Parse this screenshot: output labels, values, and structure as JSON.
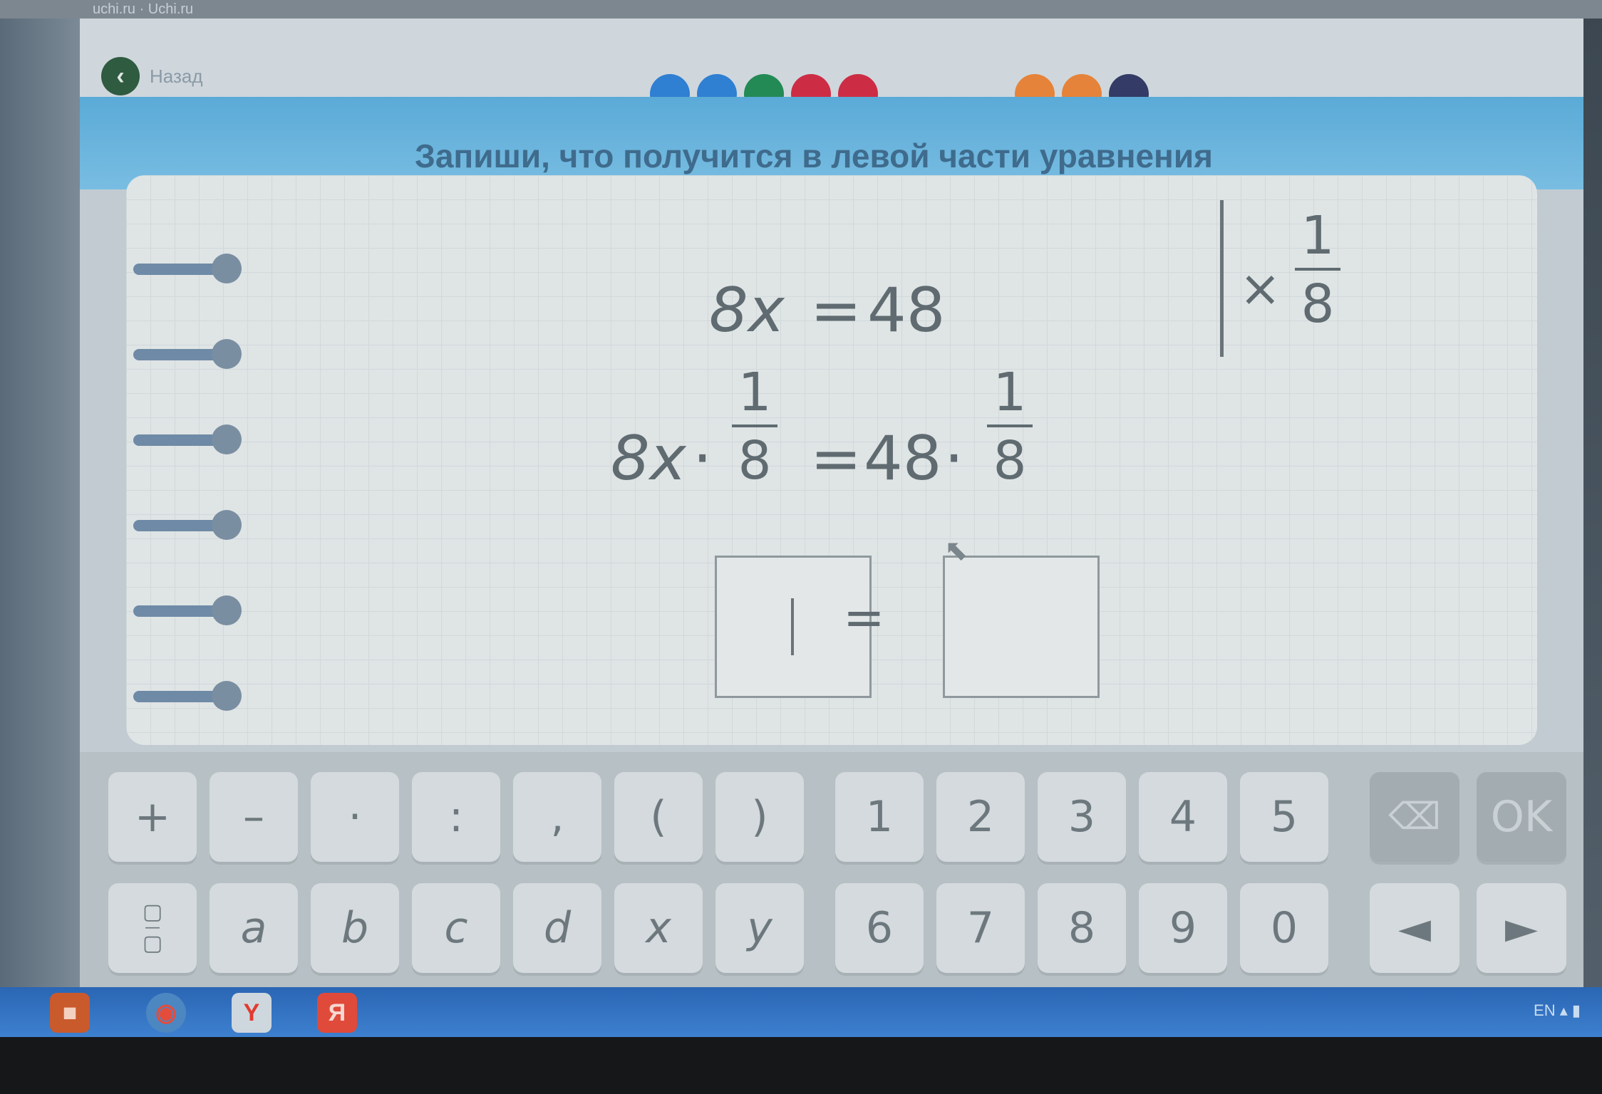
{
  "browser": {
    "tab_text": "uchi.ru · Uchi.ru"
  },
  "nav": {
    "back_label": "Назад"
  },
  "progress_dots": [
    {
      "color": "#2f7fd2"
    },
    {
      "color": "#2f7fd2"
    },
    {
      "color": "#238a55"
    },
    {
      "color": "#cc2d45"
    },
    {
      "color": "#cc2d45"
    },
    {
      "color": "#e6833a"
    },
    {
      "color": "#e6833a"
    },
    {
      "color": "#343b66"
    }
  ],
  "task": {
    "title": "Запиши, что получится в левой части уравнения"
  },
  "equation": {
    "line1_left": "8x",
    "line1_eq": "=",
    "line1_right": "48",
    "op_sign": "×",
    "op_num": "1",
    "op_den": "8",
    "line2_left": "8x",
    "line2_dot1": "·",
    "line2_num1": "1",
    "line2_den1": "8",
    "line2_eq": "=",
    "line2_right": "48",
    "line2_dot2": "·",
    "line2_num2": "1",
    "line2_den2": "8",
    "line3_eq": "="
  },
  "answer": {
    "left_value": "",
    "right_value": ""
  },
  "keyboard": {
    "row1": [
      "+",
      "–",
      "·",
      ":",
      ",",
      "(",
      ")",
      "1",
      "2",
      "3",
      "4",
      "5"
    ],
    "row2": [
      "a",
      "b",
      "c",
      "d",
      "x",
      "y",
      "6",
      "7",
      "8",
      "9",
      "0"
    ],
    "ok_label": "OK",
    "backspace_icon": "backspace-icon",
    "fraction_icon": "fraction-icon",
    "left_arrow": "◄",
    "right_arrow": "►"
  },
  "taskbar": {
    "lang": "EN"
  }
}
